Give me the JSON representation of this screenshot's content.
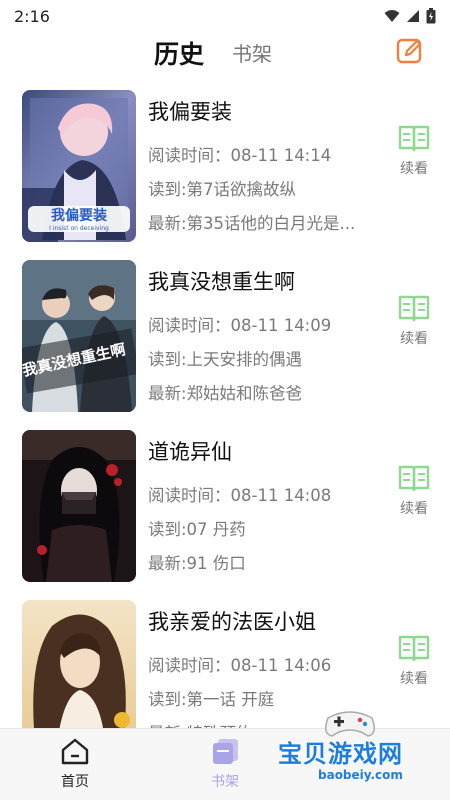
{
  "status_bar": {
    "time": "2:16"
  },
  "header": {
    "tab_history": "历史",
    "tab_shelf": "书架"
  },
  "history_items": [
    {
      "title": "我偏要装",
      "read_time": "阅读时间：08-11 14:14",
      "read_to": "读到:第7话欲擒故纵",
      "latest": "最新:第35话他的白月光是...",
      "continue_label": "续看"
    },
    {
      "title": "我真没想重生啊",
      "read_time": "阅读时间：08-11 14:09",
      "read_to": "读到:上天安排的偶遇",
      "latest": "最新:郑姑姑和陈爸爸",
      "continue_label": "续看"
    },
    {
      "title": "道诡异仙",
      "read_time": "阅读时间：08-11 14:08",
      "read_to": "读到:07 丹药",
      "latest": "最新:91 伤口",
      "continue_label": "续看"
    },
    {
      "title": "我亲爱的法医小姐",
      "read_time": "阅读时间：08-11 14:06",
      "read_to": "读到:第一话 开庭",
      "latest": "最新:特殊预约",
      "continue_label": "续看"
    }
  ],
  "cover_texts": {
    "cover1": "我偏要装",
    "cover1_sub": "I insist on deceiving",
    "cover2": "我真没想重生啊"
  },
  "bottom_nav": {
    "home": "首页",
    "shelf": "书架"
  },
  "watermark": {
    "text": "宝贝游戏网",
    "url": "baobeiy.com"
  },
  "colors": {
    "accent_green": "#8fd88f",
    "edit_orange": "#f0803c",
    "shelf_purple": "#a9a3e8",
    "watermark_blue": "#1e7de0"
  }
}
